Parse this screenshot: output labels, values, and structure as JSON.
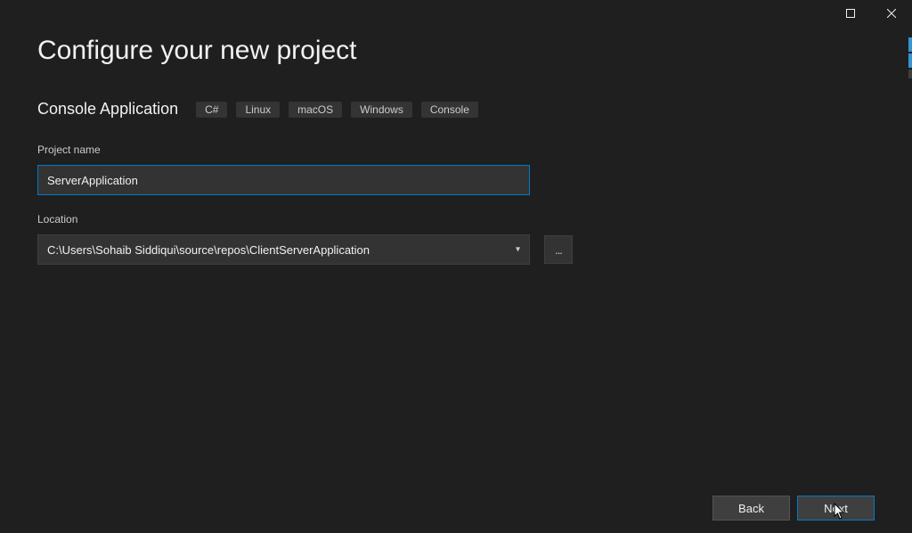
{
  "title": "Configure your new project",
  "template_name": "Console Application",
  "tags": [
    "C#",
    "Linux",
    "macOS",
    "Windows",
    "Console"
  ],
  "fields": {
    "project_name_label": "Project name",
    "project_name_value": "ServerApplication",
    "location_label": "Location",
    "location_value": "C:\\Users\\Sohaib Siddiqui\\source\\repos\\ClientServerApplication",
    "browse_label": "..."
  },
  "buttons": {
    "back": "Back",
    "next": "Next"
  }
}
